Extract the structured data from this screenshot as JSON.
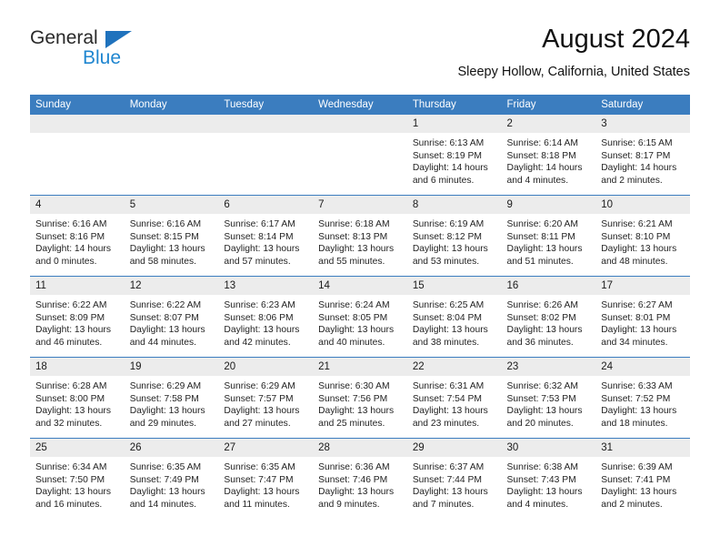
{
  "brand": {
    "name_part1": "General",
    "name_part2": "Blue"
  },
  "header": {
    "month_title": "August 2024",
    "location": "Sleepy Hollow, California, United States"
  },
  "colors": {
    "header_blue": "#3b7dbf",
    "logo_blue": "#1f86d0",
    "date_band_gray": "#ececec"
  },
  "weekday_headers": [
    "Sunday",
    "Monday",
    "Tuesday",
    "Wednesday",
    "Thursday",
    "Friday",
    "Saturday"
  ],
  "weeks": [
    [
      {
        "date": "",
        "sunrise": "",
        "sunset": "",
        "daylight_line1": "",
        "daylight_line2": ""
      },
      {
        "date": "",
        "sunrise": "",
        "sunset": "",
        "daylight_line1": "",
        "daylight_line2": ""
      },
      {
        "date": "",
        "sunrise": "",
        "sunset": "",
        "daylight_line1": "",
        "daylight_line2": ""
      },
      {
        "date": "",
        "sunrise": "",
        "sunset": "",
        "daylight_line1": "",
        "daylight_line2": ""
      },
      {
        "date": "1",
        "sunrise": "Sunrise: 6:13 AM",
        "sunset": "Sunset: 8:19 PM",
        "daylight_line1": "Daylight: 14 hours",
        "daylight_line2": "and 6 minutes."
      },
      {
        "date": "2",
        "sunrise": "Sunrise: 6:14 AM",
        "sunset": "Sunset: 8:18 PM",
        "daylight_line1": "Daylight: 14 hours",
        "daylight_line2": "and 4 minutes."
      },
      {
        "date": "3",
        "sunrise": "Sunrise: 6:15 AM",
        "sunset": "Sunset: 8:17 PM",
        "daylight_line1": "Daylight: 14 hours",
        "daylight_line2": "and 2 minutes."
      }
    ],
    [
      {
        "date": "4",
        "sunrise": "Sunrise: 6:16 AM",
        "sunset": "Sunset: 8:16 PM",
        "daylight_line1": "Daylight: 14 hours",
        "daylight_line2": "and 0 minutes."
      },
      {
        "date": "5",
        "sunrise": "Sunrise: 6:16 AM",
        "sunset": "Sunset: 8:15 PM",
        "daylight_line1": "Daylight: 13 hours",
        "daylight_line2": "and 58 minutes."
      },
      {
        "date": "6",
        "sunrise": "Sunrise: 6:17 AM",
        "sunset": "Sunset: 8:14 PM",
        "daylight_line1": "Daylight: 13 hours",
        "daylight_line2": "and 57 minutes."
      },
      {
        "date": "7",
        "sunrise": "Sunrise: 6:18 AM",
        "sunset": "Sunset: 8:13 PM",
        "daylight_line1": "Daylight: 13 hours",
        "daylight_line2": "and 55 minutes."
      },
      {
        "date": "8",
        "sunrise": "Sunrise: 6:19 AM",
        "sunset": "Sunset: 8:12 PM",
        "daylight_line1": "Daylight: 13 hours",
        "daylight_line2": "and 53 minutes."
      },
      {
        "date": "9",
        "sunrise": "Sunrise: 6:20 AM",
        "sunset": "Sunset: 8:11 PM",
        "daylight_line1": "Daylight: 13 hours",
        "daylight_line2": "and 51 minutes."
      },
      {
        "date": "10",
        "sunrise": "Sunrise: 6:21 AM",
        "sunset": "Sunset: 8:10 PM",
        "daylight_line1": "Daylight: 13 hours",
        "daylight_line2": "and 48 minutes."
      }
    ],
    [
      {
        "date": "11",
        "sunrise": "Sunrise: 6:22 AM",
        "sunset": "Sunset: 8:09 PM",
        "daylight_line1": "Daylight: 13 hours",
        "daylight_line2": "and 46 minutes."
      },
      {
        "date": "12",
        "sunrise": "Sunrise: 6:22 AM",
        "sunset": "Sunset: 8:07 PM",
        "daylight_line1": "Daylight: 13 hours",
        "daylight_line2": "and 44 minutes."
      },
      {
        "date": "13",
        "sunrise": "Sunrise: 6:23 AM",
        "sunset": "Sunset: 8:06 PM",
        "daylight_line1": "Daylight: 13 hours",
        "daylight_line2": "and 42 minutes."
      },
      {
        "date": "14",
        "sunrise": "Sunrise: 6:24 AM",
        "sunset": "Sunset: 8:05 PM",
        "daylight_line1": "Daylight: 13 hours",
        "daylight_line2": "and 40 minutes."
      },
      {
        "date": "15",
        "sunrise": "Sunrise: 6:25 AM",
        "sunset": "Sunset: 8:04 PM",
        "daylight_line1": "Daylight: 13 hours",
        "daylight_line2": "and 38 minutes."
      },
      {
        "date": "16",
        "sunrise": "Sunrise: 6:26 AM",
        "sunset": "Sunset: 8:02 PM",
        "daylight_line1": "Daylight: 13 hours",
        "daylight_line2": "and 36 minutes."
      },
      {
        "date": "17",
        "sunrise": "Sunrise: 6:27 AM",
        "sunset": "Sunset: 8:01 PM",
        "daylight_line1": "Daylight: 13 hours",
        "daylight_line2": "and 34 minutes."
      }
    ],
    [
      {
        "date": "18",
        "sunrise": "Sunrise: 6:28 AM",
        "sunset": "Sunset: 8:00 PM",
        "daylight_line1": "Daylight: 13 hours",
        "daylight_line2": "and 32 minutes."
      },
      {
        "date": "19",
        "sunrise": "Sunrise: 6:29 AM",
        "sunset": "Sunset: 7:58 PM",
        "daylight_line1": "Daylight: 13 hours",
        "daylight_line2": "and 29 minutes."
      },
      {
        "date": "20",
        "sunrise": "Sunrise: 6:29 AM",
        "sunset": "Sunset: 7:57 PM",
        "daylight_line1": "Daylight: 13 hours",
        "daylight_line2": "and 27 minutes."
      },
      {
        "date": "21",
        "sunrise": "Sunrise: 6:30 AM",
        "sunset": "Sunset: 7:56 PM",
        "daylight_line1": "Daylight: 13 hours",
        "daylight_line2": "and 25 minutes."
      },
      {
        "date": "22",
        "sunrise": "Sunrise: 6:31 AM",
        "sunset": "Sunset: 7:54 PM",
        "daylight_line1": "Daylight: 13 hours",
        "daylight_line2": "and 23 minutes."
      },
      {
        "date": "23",
        "sunrise": "Sunrise: 6:32 AM",
        "sunset": "Sunset: 7:53 PM",
        "daylight_line1": "Daylight: 13 hours",
        "daylight_line2": "and 20 minutes."
      },
      {
        "date": "24",
        "sunrise": "Sunrise: 6:33 AM",
        "sunset": "Sunset: 7:52 PM",
        "daylight_line1": "Daylight: 13 hours",
        "daylight_line2": "and 18 minutes."
      }
    ],
    [
      {
        "date": "25",
        "sunrise": "Sunrise: 6:34 AM",
        "sunset": "Sunset: 7:50 PM",
        "daylight_line1": "Daylight: 13 hours",
        "daylight_line2": "and 16 minutes."
      },
      {
        "date": "26",
        "sunrise": "Sunrise: 6:35 AM",
        "sunset": "Sunset: 7:49 PM",
        "daylight_line1": "Daylight: 13 hours",
        "daylight_line2": "and 14 minutes."
      },
      {
        "date": "27",
        "sunrise": "Sunrise: 6:35 AM",
        "sunset": "Sunset: 7:47 PM",
        "daylight_line1": "Daylight: 13 hours",
        "daylight_line2": "and 11 minutes."
      },
      {
        "date": "28",
        "sunrise": "Sunrise: 6:36 AM",
        "sunset": "Sunset: 7:46 PM",
        "daylight_line1": "Daylight: 13 hours",
        "daylight_line2": "and 9 minutes."
      },
      {
        "date": "29",
        "sunrise": "Sunrise: 6:37 AM",
        "sunset": "Sunset: 7:44 PM",
        "daylight_line1": "Daylight: 13 hours",
        "daylight_line2": "and 7 minutes."
      },
      {
        "date": "30",
        "sunrise": "Sunrise: 6:38 AM",
        "sunset": "Sunset: 7:43 PM",
        "daylight_line1": "Daylight: 13 hours",
        "daylight_line2": "and 4 minutes."
      },
      {
        "date": "31",
        "sunrise": "Sunrise: 6:39 AM",
        "sunset": "Sunset: 7:41 PM",
        "daylight_line1": "Daylight: 13 hours",
        "daylight_line2": "and 2 minutes."
      }
    ]
  ]
}
